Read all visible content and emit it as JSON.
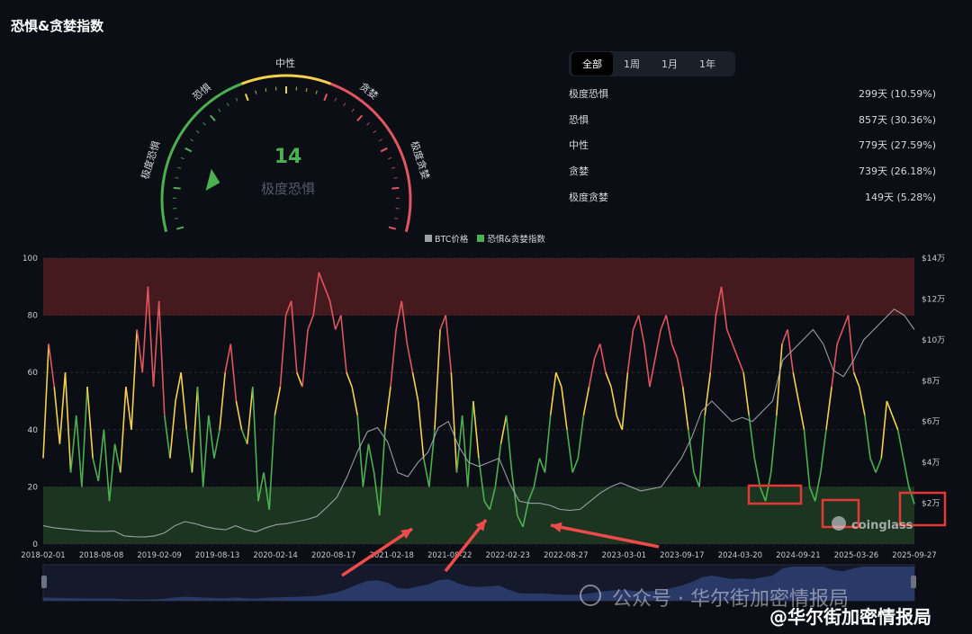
{
  "title": "恐惧&贪婪指数",
  "gauge": {
    "value": "14",
    "status": "极度恐惧",
    "pointer_value": 14,
    "labels": [
      "极度恐惧",
      "恐惧",
      "中性",
      "贪婪",
      "极度贪婪"
    ],
    "colors": {
      "fear": "#4caf50",
      "neutral": "#f3d04e",
      "greed": "#e0555f"
    }
  },
  "tabs": [
    "全部",
    "1周",
    "1月",
    "1年"
  ],
  "active_tab": "全部",
  "stats": [
    {
      "label": "极度恐惧",
      "value": "299天 (10.59%)"
    },
    {
      "label": "恐惧",
      "value": "857天 (30.36%)"
    },
    {
      "label": "中性",
      "value": "779天 (27.59%)"
    },
    {
      "label": "贪婪",
      "value": "739天 (26.18%)"
    },
    {
      "label": "极度贪婪",
      "value": "149天 (5.28%)"
    }
  ],
  "chart_data": {
    "type": "line",
    "legend": [
      "BTC价格",
      "恐惧&贪婪指数"
    ],
    "legend_colors": [
      "#9aa0a6",
      "#4caf50"
    ],
    "x_ticks": [
      "2018-02-01",
      "2018-08-08",
      "2019-02-09",
      "2019-08-13",
      "2020-02-14",
      "2020-08-17",
      "2021-02-18",
      "2021-08-22",
      "2022-02-23",
      "2022-08-27",
      "2023-03-01",
      "2023-09-17",
      "2024-03-20",
      "2024-09-21",
      "2025-03-26",
      "2025-09-27"
    ],
    "y_left": {
      "ticks": [
        "0",
        "20",
        "40",
        "60",
        "80",
        "100"
      ],
      "range": [
        0,
        100
      ]
    },
    "y_right": {
      "ticks": [
        "$2万",
        "$4万",
        "$6万",
        "$8万",
        "$10万",
        "$12万",
        "$14万"
      ],
      "range": [
        0,
        140000
      ]
    },
    "zones": [
      {
        "from": 0,
        "to": 20,
        "color": "#1e3a22"
      },
      {
        "from": 80,
        "to": 100,
        "color": "#4a1c20"
      }
    ],
    "series": [
      {
        "name": "恐惧&贪婪指数",
        "values": [
          30,
          70,
          55,
          35,
          60,
          25,
          45,
          20,
          55,
          30,
          22,
          40,
          15,
          35,
          25,
          55,
          40,
          75,
          60,
          90,
          55,
          85,
          45,
          30,
          50,
          60,
          40,
          25,
          55,
          20,
          45,
          30,
          40,
          60,
          70,
          50,
          40,
          35,
          55,
          15,
          25,
          12,
          45,
          55,
          80,
          85,
          60,
          55,
          75,
          80,
          95,
          90,
          85,
          75,
          80,
          60,
          55,
          45,
          20,
          35,
          25,
          10,
          40,
          55,
          75,
          85,
          70,
          60,
          50,
          30,
          20,
          40,
          75,
          80,
          60,
          25,
          45,
          20,
          50,
          30,
          15,
          12,
          20,
          35,
          45,
          25,
          10,
          6,
          15,
          20,
          30,
          25,
          45,
          60,
          55,
          40,
          25,
          30,
          45,
          55,
          65,
          70,
          60,
          55,
          45,
          40,
          60,
          75,
          80,
          70,
          55,
          65,
          75,
          80,
          70,
          65,
          55,
          40,
          25,
          20,
          45,
          60,
          80,
          90,
          75,
          70,
          65,
          60,
          45,
          30,
          20,
          15,
          25,
          45,
          70,
          75,
          60,
          50,
          40,
          20,
          15,
          25,
          40,
          55,
          70,
          75,
          80,
          60,
          55,
          45,
          30,
          25,
          30,
          50,
          45,
          40,
          30,
          20,
          14
        ]
      },
      {
        "name": "BTC价格",
        "values": [
          9000,
          8000,
          7500,
          7000,
          6500,
          6300,
          6200,
          6400,
          4000,
          3600,
          3500,
          4000,
          5500,
          9000,
          11000,
          10000,
          8500,
          7500,
          7000,
          9000,
          7000,
          6000,
          8000,
          9500,
          10000,
          11000,
          12000,
          13500,
          18000,
          23000,
          33000,
          45000,
          55000,
          57000,
          50000,
          35000,
          33000,
          40000,
          45000,
          57000,
          60000,
          48000,
          40000,
          38000,
          40000,
          42000,
          30000,
          21000,
          20000,
          20000,
          19000,
          17000,
          16500,
          17000,
          21000,
          25000,
          28000,
          30000,
          28000,
          26000,
          27000,
          28000,
          35000,
          42000,
          52000,
          65000,
          70000,
          65000,
          60000,
          62000,
          60000,
          65000,
          70000,
          90000,
          95000,
          100000,
          105000,
          98000,
          85000,
          82000,
          90000,
          100000,
          105000,
          110000,
          115000,
          112000,
          105000
        ]
      }
    ]
  },
  "watermark": {
    "line1": "公众号 · 华尔街加密情报局",
    "line2": "@华尔街加密情报局",
    "brand": "coinglass"
  }
}
